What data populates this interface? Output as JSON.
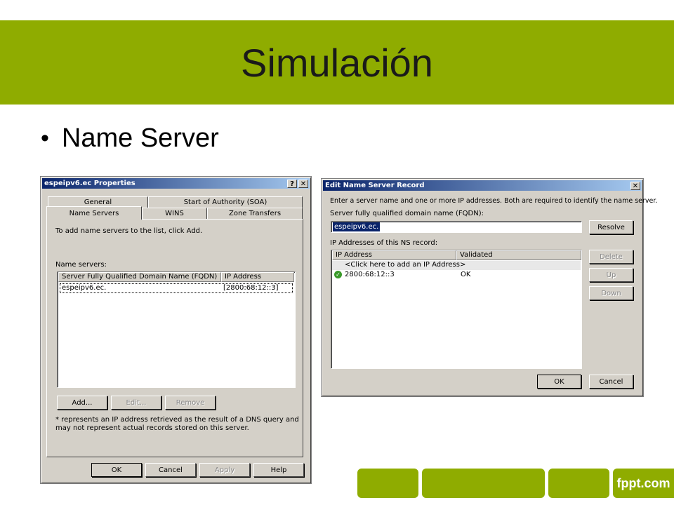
{
  "slide": {
    "title": "Simulación",
    "bullet": "Name Server",
    "footer_brand": "fppt.com",
    "accent_color": "#8fac00"
  },
  "properties_dialog": {
    "title": "espeipv6.ec Properties",
    "help_btn": "?",
    "close_btn": "✕",
    "tabs_row1": [
      "General",
      "Start of Authority (SOA)"
    ],
    "tabs_row2": [
      "Name Servers",
      "WINS",
      "Zone Transfers"
    ],
    "active_tab": "Name Servers",
    "instruction": "To add name servers to the list, click Add.",
    "list_label": "Name servers:",
    "columns": [
      "Server Fully Qualified Domain Name (FQDN)",
      "IP Address"
    ],
    "rows": [
      {
        "fqdn": "espeipv6.ec.",
        "ip": "[2800:68:12::3]"
      }
    ],
    "buttons": {
      "add": "Add...",
      "edit": "Edit...",
      "remove": "Remove"
    },
    "footnote_line1": "* represents an IP address retrieved as the result of a DNS query and",
    "footnote_line2": "may not represent actual records stored on this server.",
    "bottom_buttons": {
      "ok": "OK",
      "cancel": "Cancel",
      "apply": "Apply",
      "help": "Help"
    }
  },
  "edit_dialog": {
    "title": "Edit Name Server Record",
    "close_btn": "✕",
    "instruction": "Enter a server name and one or more IP addresses.  Both are required to identify the name server.",
    "fqdn_label": "Server fully qualified domain name (FQDN):",
    "fqdn_value": "espeipv6.ec.",
    "resolve": "Resolve",
    "ip_label": "IP Addresses of this NS record:",
    "columns": [
      "IP Address",
      "Validated"
    ],
    "add_row": "<Click here to add an IP Address>",
    "rows": [
      {
        "ip": "2800:68:12::3",
        "validated": "OK"
      }
    ],
    "side_buttons": {
      "delete": "Delete",
      "up": "Up",
      "down": "Down"
    },
    "bottom_buttons": {
      "ok": "OK",
      "cancel": "Cancel"
    }
  }
}
